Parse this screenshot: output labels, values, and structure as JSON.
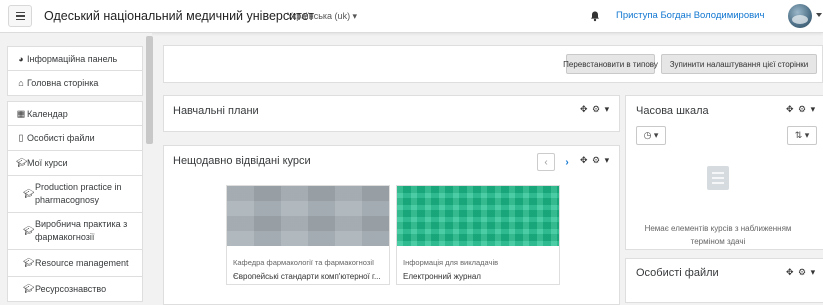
{
  "navbar": {
    "site_name": "Одеський національний медичний університет",
    "language": "Українська (uk) ▾",
    "user_name": "Приступа Богдан Володимирович"
  },
  "drawer": {
    "items": [
      {
        "label": "Інформаційна панель",
        "icon": "dashboard-icon"
      },
      {
        "label": "Головна сторінка",
        "icon": "home-icon"
      },
      {
        "label": "Календар",
        "icon": "calendar-icon"
      },
      {
        "label": "Особисті файли",
        "icon": "file-icon"
      },
      {
        "label": "Мої курси",
        "icon": "graduation-cap-icon"
      },
      {
        "label": "Production practice in pharmacognosy",
        "icon": "graduation-cap-icon"
      },
      {
        "label": "Виробнича практика з фармакогнозії",
        "icon": "graduation-cap-icon"
      },
      {
        "label": "Resource management",
        "icon": "graduation-cap-icon"
      },
      {
        "label": "Ресурсознавство",
        "icon": "graduation-cap-icon"
      }
    ]
  },
  "page_header": {
    "reset_button": "Перевстановити в типову",
    "stop_customizing_button": "Зупинити налаштування цієї сторінки"
  },
  "blocks": {
    "study_plans": {
      "title": "Навчальні плани"
    },
    "recent_courses": {
      "title": "Нещодавно відвідані курси",
      "courses": [
        {
          "category": "Кафедра фармакології та фармакогнозії",
          "name": "Європейські стандарти комп'ютерної г..."
        },
        {
          "category": "Інформація для викладачів",
          "name": "Електронний журнал"
        }
      ]
    },
    "timeline": {
      "title": "Часова шкала",
      "empty_text": "Немає елементів курсів з наближенням терміном здачі"
    },
    "private_files": {
      "title": "Особисті файли"
    }
  },
  "colors": {
    "link": "#1177d1",
    "accent_green": "#1bbf8c",
    "panel_border": "#dedede"
  }
}
